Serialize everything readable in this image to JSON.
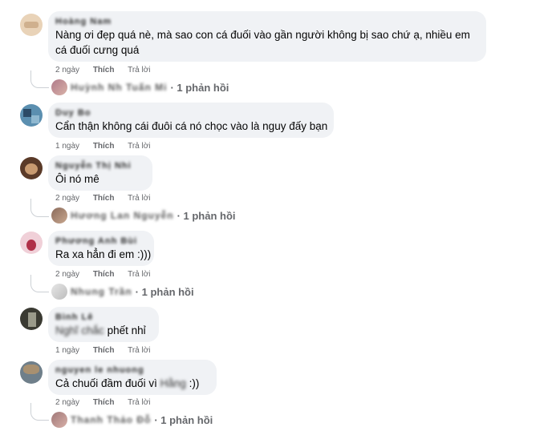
{
  "labels": {
    "like": "Thích",
    "reply": "Trả lời"
  },
  "comments": [
    {
      "author": "Hoàng Nam",
      "text_line1": "Nàng ơi đẹp quá nè, mà sao con cá đuối vào gần người không bị sao chứ ạ, nhiều em",
      "text_line2": "cá đuối cưng quá",
      "time": "2 ngày",
      "reply_names": "Huỳnh Nh Tuấn Mi",
      "reply_count": "· 1 phản hồi"
    },
    {
      "author": "Duy Bo",
      "text_line1": "Cẩn thận không cái đuôi cá nó chọc vào là nguy đấy bạn",
      "time": "1 ngày"
    },
    {
      "author": "Nguyễn Thị Nhi",
      "text_line1": "Ôi nó mê",
      "time": "2 ngày",
      "reply_names": "Hương Lan Nguyễn",
      "reply_count": "· 1 phản hồi"
    },
    {
      "author": "Phương Anh Bùi",
      "text_line1": "Ra xa hẳn đi em :)))",
      "time": "2 ngày",
      "reply_names": "Nhung Trần",
      "reply_count": "· 1 phản hồi"
    },
    {
      "author": "Bình Lê",
      "text_blur": "Nghĩ chắc",
      "text_line1": "phết nhỉ",
      "time": "1 ngày"
    },
    {
      "author": "nguyen le nhuong",
      "text_line1": "Cả chuối đầm đuối vì",
      "text_blur": "Hằng",
      "text_tail": ":))",
      "time": "2 ngày",
      "reply_names": "Thanh Thảo Đỗ",
      "reply_count": "· 1 phản hồi"
    }
  ]
}
